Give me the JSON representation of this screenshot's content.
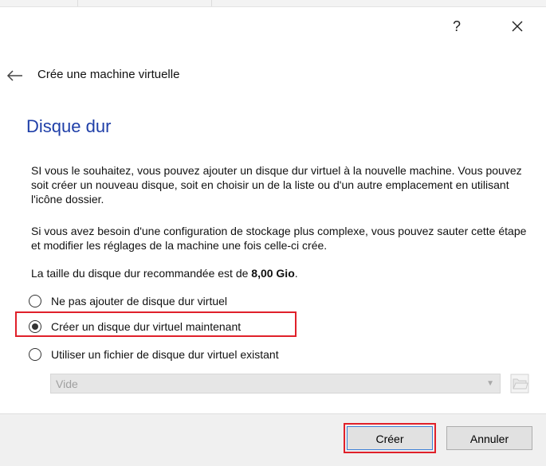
{
  "window": {
    "help_label": "?",
    "close_icon": "close-icon",
    "back_icon": "back-arrow-icon",
    "wizard_title": "Crée une machine virtuelle"
  },
  "page": {
    "title": "Disque dur",
    "paragraph1": "SI vous le souhaitez, vous pouvez ajouter un disque dur virtuel à la nouvelle machine. Vous pouvez soit créer un nouveau disque, soit en choisir un de la liste ou d'un autre emplacement en utilisant l'icône dossier.",
    "paragraph2": "Si vous avez besoin d'une configuration de stockage plus complexe, vous pouvez sauter cette étape et modifier les réglages de la machine une fois celle-ci crée.",
    "paragraph3_prefix": "La taille du disque dur recommandée est de ",
    "recommended_size": "8,00 Gio",
    "paragraph3_suffix": "."
  },
  "options": [
    {
      "label": "Ne pas ajouter de disque dur virtuel",
      "selected": false
    },
    {
      "label": "Créer un disque dur virtuel maintenant",
      "selected": true
    },
    {
      "label": "Utiliser un fichier de disque dur virtuel existant",
      "selected": false
    }
  ],
  "disk_select": {
    "value": "Vide",
    "enabled": false,
    "folder_icon": "folder-icon"
  },
  "buttons": {
    "create": "Créer",
    "cancel": "Annuler"
  },
  "colors": {
    "title": "#1f3fa8",
    "highlight": "#e0202a",
    "footer_bg": "#f0f0f0"
  }
}
